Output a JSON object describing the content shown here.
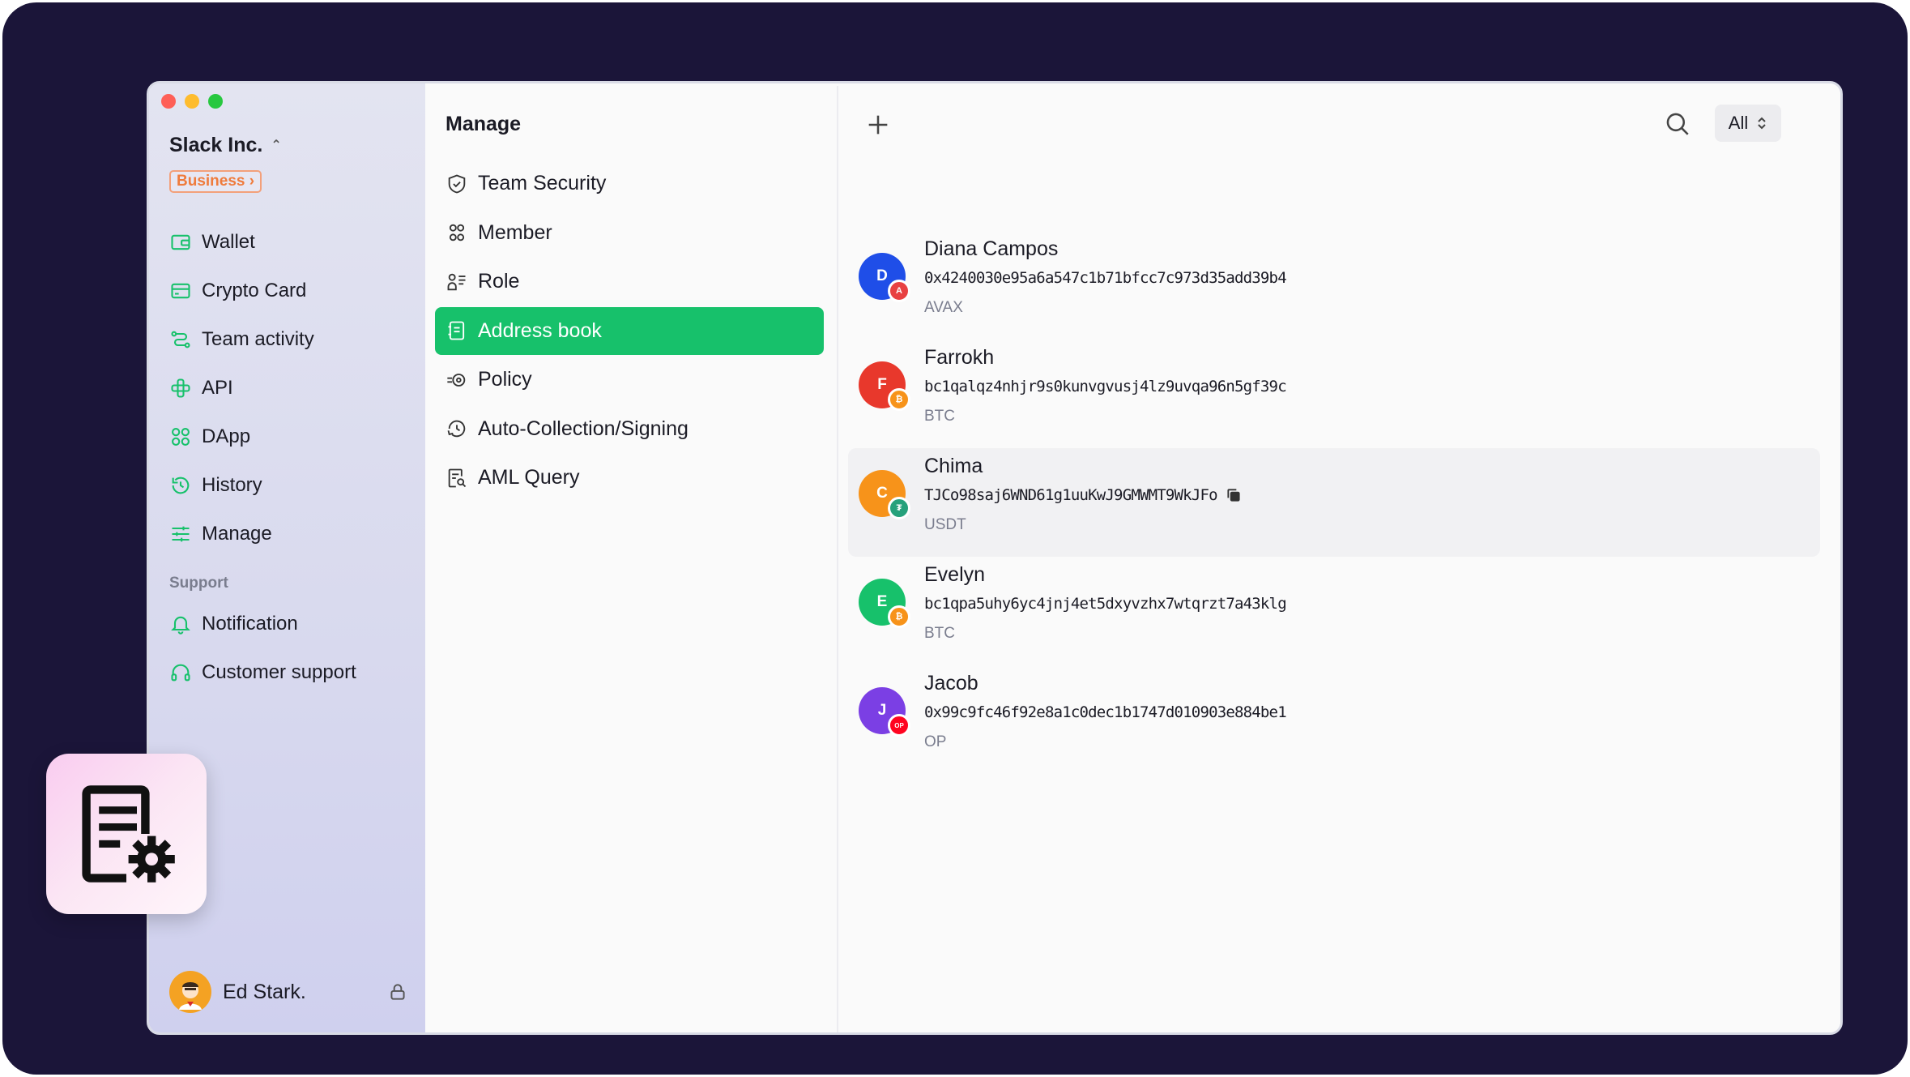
{
  "org": {
    "name": "Slack Inc.",
    "plan_badge": "Business ›"
  },
  "sidebar": {
    "items": [
      {
        "label": "Wallet",
        "icon": "wallet-icon"
      },
      {
        "label": "Crypto Card",
        "icon": "card-icon"
      },
      {
        "label": "Team activity",
        "icon": "activity-icon"
      },
      {
        "label": "API",
        "icon": "api-icon"
      },
      {
        "label": "DApp",
        "icon": "dapp-icon"
      },
      {
        "label": "History",
        "icon": "history-icon"
      },
      {
        "label": "Manage",
        "icon": "sliders-icon"
      }
    ],
    "support_label": "Support",
    "support_items": [
      {
        "label": "Notification",
        "icon": "bell-icon"
      },
      {
        "label": "Customer support",
        "icon": "headset-icon"
      }
    ],
    "user_name": "Ed Stark."
  },
  "manage": {
    "title": "Manage",
    "items": [
      {
        "label": "Team Security",
        "icon": "shield-icon"
      },
      {
        "label": "Member",
        "icon": "members-icon"
      },
      {
        "label": "Role",
        "icon": "role-icon"
      },
      {
        "label": "Address book",
        "icon": "address-book-icon",
        "active": true
      },
      {
        "label": "Policy",
        "icon": "policy-icon"
      },
      {
        "label": "Auto-Collection/Signing",
        "icon": "auto-collection-icon"
      },
      {
        "label": "AML Query",
        "icon": "aml-query-icon"
      }
    ]
  },
  "toolbar": {
    "filter_value": "All"
  },
  "addresses": [
    {
      "initial": "D",
      "name": "Diana Campos",
      "address": "0x4240030e95a6a547c1b71bfcc7c973d35add39b4",
      "network": "AVAX",
      "avatar_color": "#1f4ee8",
      "chain_color": "#e84142",
      "chain_glyph": "A"
    },
    {
      "initial": "F",
      "name": "Farrokh",
      "address": "bc1qalqz4nhjr9s0kunvgvusj4lz9uvqa96n5gf39c",
      "network": "BTC",
      "avatar_color": "#e8382c",
      "chain_color": "#f7931a",
      "chain_glyph": "₿"
    },
    {
      "initial": "C",
      "name": "Chima",
      "address": "TJCo98saj6WND61g1uuKwJ9GMWMT9WkJFo",
      "network": "USDT",
      "avatar_color": "#f7931a",
      "chain_color": "#26a17b",
      "chain_glyph": "₮"
    },
    {
      "initial": "E",
      "name": "Evelyn",
      "address": "bc1qpa5uhy6yc4jnj4et5dxyvzhx7wtqrzt7a43klg",
      "network": "BTC",
      "avatar_color": "#17c16b",
      "chain_color": "#f7931a",
      "chain_glyph": "₿"
    },
    {
      "initial": "J",
      "name": "Jacob",
      "address": "0x99c9fc46f92e8a1c0dec1b1747d010903e884be1",
      "network": "OP",
      "avatar_color": "#7b3fe4",
      "chain_color": "#ff0420",
      "chain_glyph": "OP"
    }
  ]
}
